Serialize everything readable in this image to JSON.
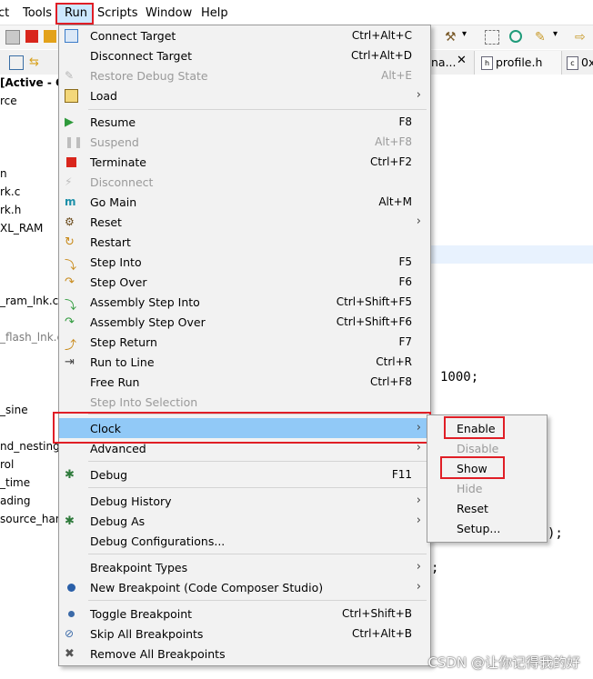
{
  "menubar": {
    "items": [
      {
        "label": "ct"
      },
      {
        "label": "Tools"
      },
      {
        "label": "Run"
      },
      {
        "label": "Scripts"
      },
      {
        "label": "Window"
      },
      {
        "label": "Help"
      }
    ]
  },
  "tabs": [
    {
      "label": "na..."
    },
    {
      "label": "profile.h"
    },
    {
      "label": "0x"
    }
  ],
  "left_panel": {
    "items": [
      "[Active - C",
      "rce",
      "n",
      "rk.c",
      "rk.h",
      "XL_RAM",
      "_ram_lnk.cr",
      "_flash_lnk.c",
      "_sine",
      "nd_nesting_",
      "rol",
      "_time",
      "ading",
      "source_han"
    ]
  },
  "run_menu": {
    "items": [
      {
        "label": "Connect Target",
        "shortcut": "Ctrl+Alt+C"
      },
      {
        "label": "Disconnect Target",
        "shortcut": "Ctrl+Alt+D"
      },
      {
        "label": "Restore Debug State",
        "shortcut": "Alt+E"
      },
      {
        "label": "Load",
        "shortcut": ""
      },
      {
        "label": "Resume",
        "shortcut": "F8"
      },
      {
        "label": "Suspend",
        "shortcut": "Alt+F8"
      },
      {
        "label": "Terminate",
        "shortcut": "Ctrl+F2"
      },
      {
        "label": "Disconnect",
        "shortcut": ""
      },
      {
        "label": "Go Main",
        "shortcut": "Alt+M"
      },
      {
        "label": "Reset",
        "shortcut": ""
      },
      {
        "label": "Restart",
        "shortcut": ""
      },
      {
        "label": "Step Into",
        "shortcut": "F5"
      },
      {
        "label": "Step Over",
        "shortcut": "F6"
      },
      {
        "label": "Assembly Step Into",
        "shortcut": "Ctrl+Shift+F5"
      },
      {
        "label": "Assembly Step Over",
        "shortcut": "Ctrl+Shift+F6"
      },
      {
        "label": "Step Return",
        "shortcut": "F7"
      },
      {
        "label": "Run to Line",
        "shortcut": "Ctrl+R"
      },
      {
        "label": "Free Run",
        "shortcut": "Ctrl+F8"
      },
      {
        "label": "Step Into Selection",
        "shortcut": ""
      },
      {
        "label": "Clock",
        "shortcut": ""
      },
      {
        "label": "Advanced",
        "shortcut": ""
      },
      {
        "label": "Debug",
        "shortcut": "F11"
      },
      {
        "label": "Debug History",
        "shortcut": ""
      },
      {
        "label": "Debug As",
        "shortcut": ""
      },
      {
        "label": "Debug Configurations...",
        "shortcut": ""
      },
      {
        "label": "Breakpoint Types",
        "shortcut": ""
      },
      {
        "label": "New Breakpoint (Code Composer Studio)",
        "shortcut": ""
      },
      {
        "label": "Toggle Breakpoint",
        "shortcut": "Ctrl+Shift+B"
      },
      {
        "label": "Skip All Breakpoints",
        "shortcut": "Ctrl+Alt+B"
      },
      {
        "label": "Remove All Breakpoints",
        "shortcut": ""
      }
    ]
  },
  "clock_submenu": {
    "items": [
      {
        "label": "Enable"
      },
      {
        "label": "Disable"
      },
      {
        "label": "Show"
      },
      {
        "label": "Hide"
      },
      {
        "label": "Reset"
      },
      {
        "label": "Setup..."
      }
    ]
  },
  "editor": {
    "line1": "1000;",
    "line2": ");",
    "line3": ";"
  },
  "watermark": "CSDN @让你记得我的好",
  "colors": {
    "highlight": "#91c9f7",
    "annotation_red": "#e01e26",
    "menu_bg": "#f2f2f2",
    "disabled_text": "#9a9a9a"
  }
}
